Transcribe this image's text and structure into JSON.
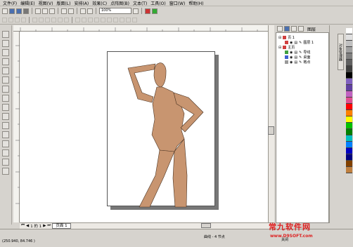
{
  "menu": [
    "文件(F)",
    "编辑(E)",
    "视图(V)",
    "版面(L)",
    "安排(A)",
    "效果(C)",
    "点阵图(B)",
    "文本(T)",
    "工具(O)",
    "窗口(W)",
    "帮助(H)"
  ],
  "toolbar": {
    "zoom": "100%"
  },
  "page_nav": {
    "counter": "1 的 1",
    "tab": "页面 1"
  },
  "docker": {
    "tab_label": "图层",
    "side_tab": "对象管理器",
    "rows": [
      {
        "label": "页 1",
        "color": "#d04040"
      },
      {
        "label": "图层 1",
        "color": "#d04040"
      },
      {
        "label": "主页",
        "color": "#d04040"
      },
      {
        "label": "导线",
        "color": "#40a040"
      },
      {
        "label": "桌面",
        "color": "#4060d0"
      },
      {
        "label": "格点",
        "color": "#999999"
      }
    ]
  },
  "status": {
    "coords": "(250.940, 84.746 )",
    "node_info": "曲线 - 4 节点",
    "object_info": "关闭"
  },
  "watermark": {
    "brand": "常九软件网",
    "url": "www.D9SOFT.com"
  },
  "colors": {
    "figure": "#c89570",
    "figure_stroke": "#4a3322"
  },
  "palette": [
    "#ffffff",
    "#e0e0e0",
    "#c0c0c0",
    "#a0a0a0",
    "#808080",
    "#606060",
    "#404040",
    "#000000",
    "#8060c0",
    "#6040a0",
    "#c060c0",
    "#e05090",
    "#ff0000",
    "#ff8000",
    "#ffff00",
    "#00c000",
    "#008000",
    "#00c0c0",
    "#0080ff",
    "#0000c0",
    "#000080",
    "#804000",
    "#c08040"
  ]
}
